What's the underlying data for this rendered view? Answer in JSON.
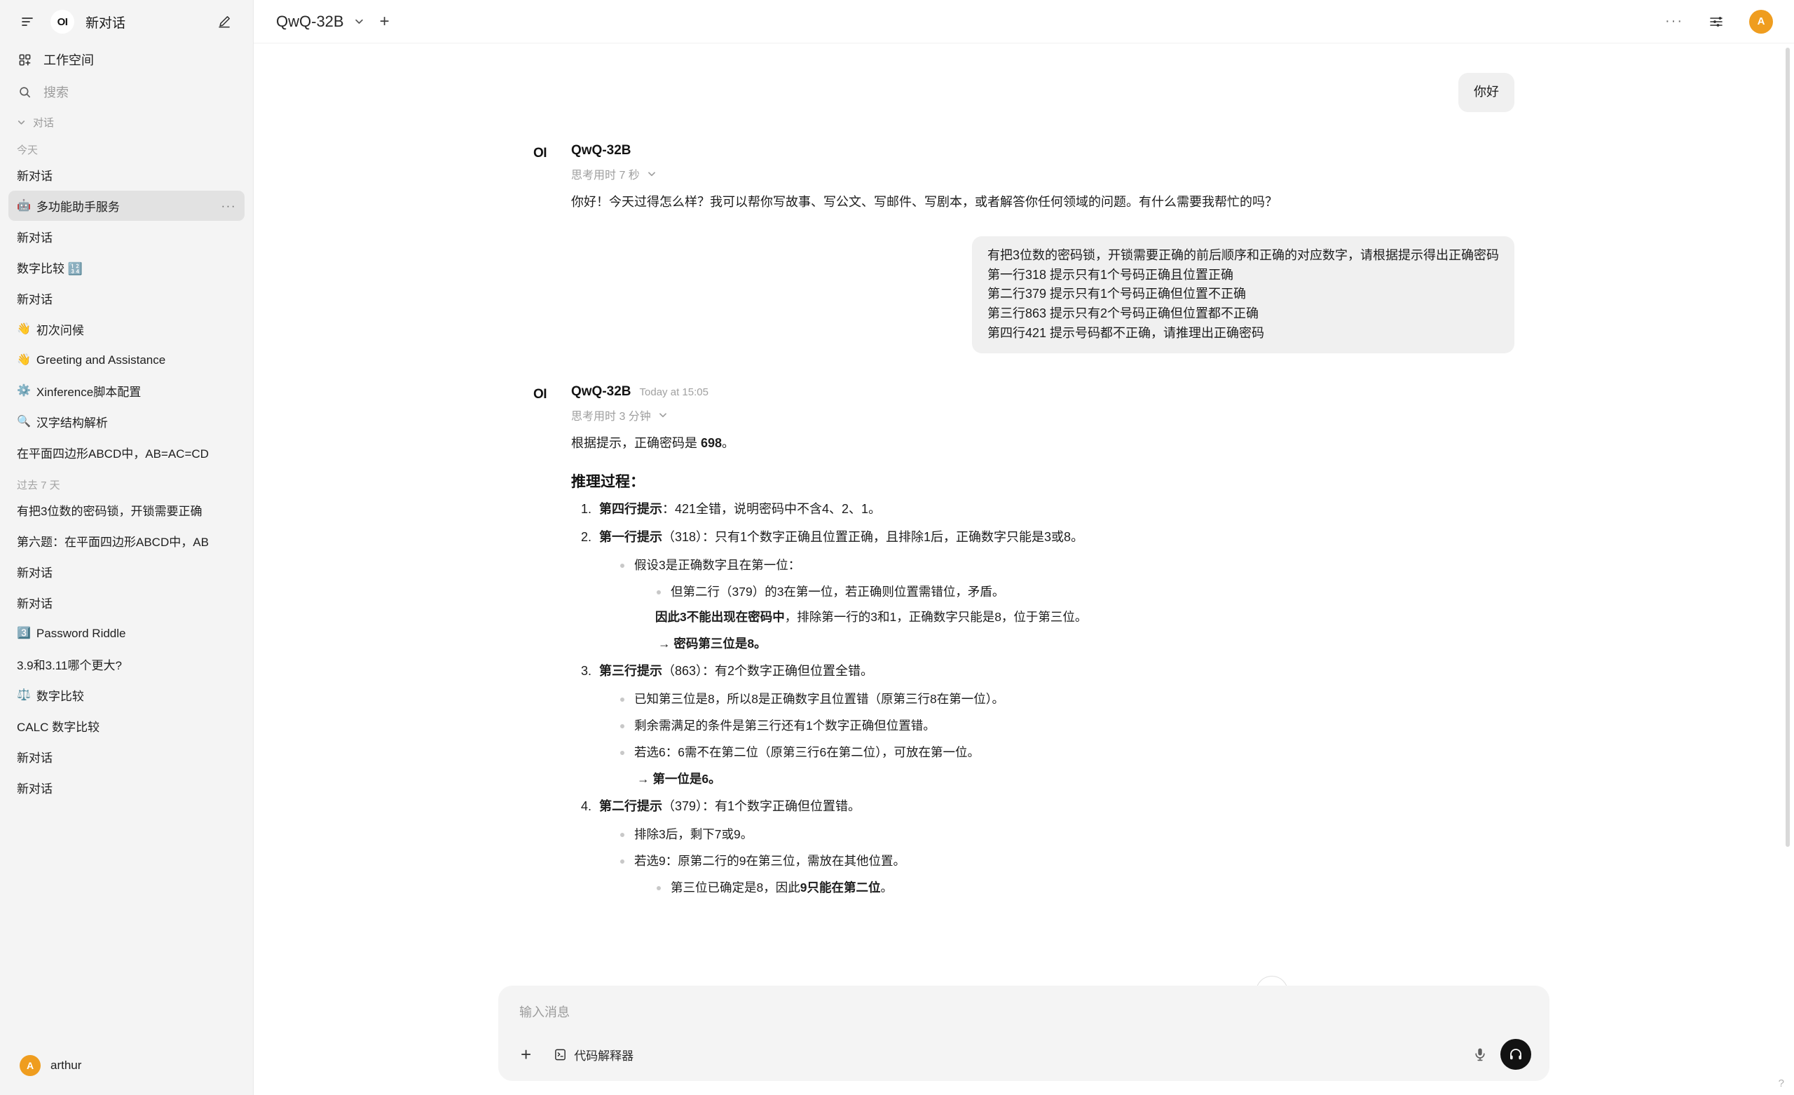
{
  "sidebar": {
    "title": "新对话",
    "logo_text": "OI",
    "workspace_label": "工作空间",
    "search_placeholder": "搜索",
    "chats_section": "对话",
    "group_today": "今天",
    "group_past7": "过去 7 天",
    "today_items": [
      {
        "emoji": "",
        "label": "新对话",
        "active": false,
        "dots": ""
      },
      {
        "emoji": "🤖",
        "label": "多功能助手服务",
        "active": true,
        "dots": "···"
      },
      {
        "emoji": "",
        "label": "新对话",
        "active": false,
        "dots": ""
      },
      {
        "emoji": "",
        "label": "数字比较 🔢",
        "active": false,
        "dots": ""
      },
      {
        "emoji": "",
        "label": "新对话",
        "active": false,
        "dots": ""
      },
      {
        "emoji": "👋",
        "label": "初次问候",
        "active": false,
        "dots": ""
      },
      {
        "emoji": "👋",
        "label": "Greeting and Assistance",
        "active": false,
        "dots": ""
      },
      {
        "emoji": "⚙️",
        "label": "Xinference脚本配置",
        "active": false,
        "dots": ""
      },
      {
        "emoji": "🔍",
        "label": "汉字结构解析",
        "active": false,
        "dots": ""
      },
      {
        "emoji": "",
        "label": "在平面四边形ABCD中，AB=AC=CD",
        "active": false,
        "dots": ""
      }
    ],
    "past7_items": [
      {
        "emoji": "",
        "label": "有把3位数的密码锁，开锁需要正确",
        "active": false,
        "dots": ""
      },
      {
        "emoji": "",
        "label": "第六题：在平面四边形ABCD中，AB",
        "active": false,
        "dots": ""
      },
      {
        "emoji": "",
        "label": "新对话",
        "active": false,
        "dots": ""
      },
      {
        "emoji": "",
        "label": "新对话",
        "active": false,
        "dots": ""
      },
      {
        "emoji": "3️⃣",
        "label": "Password Riddle",
        "active": false,
        "dots": ""
      },
      {
        "emoji": "",
        "label": "3.9和3.11哪个更大?",
        "active": false,
        "dots": ""
      },
      {
        "emoji": "⚖️",
        "label": "数字比较",
        "active": false,
        "dots": ""
      },
      {
        "emoji": "",
        "label": "CALC 数字比较",
        "active": false,
        "dots": ""
      },
      {
        "emoji": "",
        "label": "新对话",
        "active": false,
        "dots": ""
      },
      {
        "emoji": "",
        "label": "新对话",
        "active": false,
        "dots": ""
      }
    ],
    "user_name": "arthur",
    "user_initial": "A"
  },
  "topbar": {
    "model": "QwQ-32B",
    "dots": "···",
    "avatar_initial": "A"
  },
  "conversation": {
    "user_greeting": "你好",
    "assistant1": {
      "name": "QwQ-32B",
      "time": "",
      "thinking": "思考用时 7 秒",
      "text": "你好！今天过得怎么样？我可以帮你写故事、写公文、写邮件、写剧本，或者解答你任何领域的问题。有什么需要我帮忙的吗？"
    },
    "user_riddle_lines": [
      "有把3位数的密码锁，开锁需要正确的前后顺序和正确的对应数字，请根据提示得出正确密码",
      "第一行318 提示只有1个号码正确且位置正确",
      "第二行379 提示只有1个号码正确但位置不正确",
      "第三行863 提示只有2个号码正确但位置都不正确",
      "第四行421 提示号码都不正确，请推理出正确密码"
    ],
    "assistant2": {
      "name": "QwQ-32B",
      "time": "Today at 15:05",
      "thinking": "思考用时 3 分钟",
      "answer_prefix": "根据提示，正确密码是 ",
      "answer_code": "698",
      "answer_suffix": "。",
      "heading": "推理过程：",
      "step1_bold": "第四行提示",
      "step1_rest": "：421全错，说明密码中不含4、2、1。",
      "step2_bold": "第一行提示",
      "step2_rest": "（318）：只有1个数字正确且位置正确，且排除1后，正确数字只能是3或8。",
      "step2_sub1": "假设3是正确数字且在第一位：",
      "step2_sub1a": "但第二行（379）的3在第一位，若正确则位置需错位，矛盾。",
      "step2_sub1b_bold": "因此3不能出现在密码中",
      "step2_sub1b_rest": "，排除第一行的3和1，正确数字只能是8，位于第三位。",
      "step2_arrow": "→ 密码第三位是8。",
      "step3_bold": "第三行提示",
      "step3_rest": "（863）：有2个数字正确但位置全错。",
      "step3_sub1": "已知第三位是8，所以8是正确数字且位置错（原第三行8在第一位）。",
      "step3_sub2": "剩余需满足的条件是第三行还有1个数字正确但位置错。",
      "step3_sub3": "若选6：6需不在第二位（原第三行6在第二位），可放在第一位。",
      "step3_arrow": "→ 第一位是6。",
      "step4_bold": "第二行提示",
      "step4_rest": "（379）：有1个数字正确但位置错。",
      "step4_sub1": "排除3后，剩下7或9。",
      "step4_sub2": "若选9：原第二行的9在第三位，需放在其他位置。",
      "step4_sub2a_pre": "第三位已确定是8，因此",
      "step4_sub2a_bold": "9只能在第二位",
      "step4_sub2a_post": "。"
    }
  },
  "composer": {
    "placeholder": "输入消息",
    "tool_label": "代码解释器",
    "plus": "+",
    "help": "?"
  }
}
